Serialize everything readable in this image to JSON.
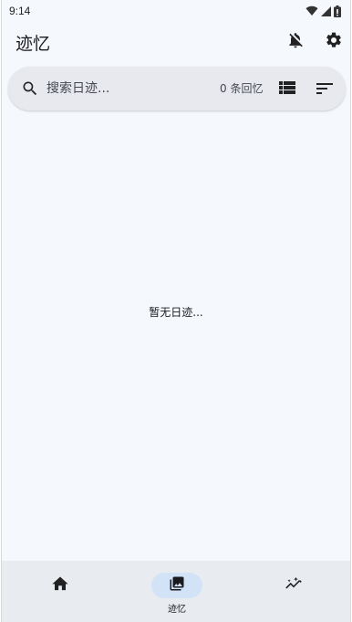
{
  "status_bar": {
    "time": "9:14",
    "icons": [
      "wifi-icon",
      "cell-signal-icon",
      "battery-icon"
    ]
  },
  "app_bar": {
    "title": "迹忆",
    "actions": [
      "notifications-off-icon",
      "gear-icon"
    ]
  },
  "search": {
    "placeholder": "搜索日迹...",
    "value": "",
    "count_label": "0 条回忆",
    "actions": [
      "view-list-icon",
      "sort-icon"
    ]
  },
  "main": {
    "empty_text": "暂无日迹..."
  },
  "bottom_nav": {
    "items": [
      {
        "icon": "home-icon",
        "label": "",
        "selected": false
      },
      {
        "icon": "photo-library-icon",
        "label": "迹忆",
        "selected": true
      },
      {
        "icon": "insights-icon",
        "label": "",
        "selected": false
      }
    ]
  },
  "colors": {
    "background": "#f5f8fd",
    "search_bar": "#e7e9ee",
    "nav_bar": "#e8ebf0",
    "selected_pill": "#d2e3f7",
    "text": "#1b1b1f"
  }
}
